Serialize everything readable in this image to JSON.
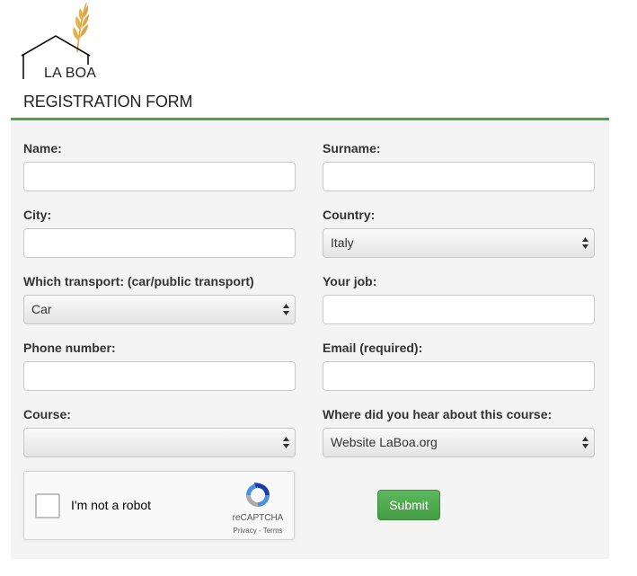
{
  "logo": {
    "text": "LA BOA",
    "icon": "house-wheat-icon"
  },
  "form": {
    "title": "REGISTRATION FORM",
    "name": {
      "label": "Name:",
      "value": ""
    },
    "surname": {
      "label": "Surname:",
      "value": ""
    },
    "city": {
      "label": "City:",
      "value": ""
    },
    "country": {
      "label": "Country:",
      "selected": "Italy"
    },
    "transport": {
      "label": "Which transport: (car/public transport)",
      "selected": "Car"
    },
    "job": {
      "label": "Your job:",
      "value": ""
    },
    "phone": {
      "label": "Phone number:",
      "value": ""
    },
    "email": {
      "label": "Email (required):",
      "value": ""
    },
    "course": {
      "label": "Course:",
      "selected": ""
    },
    "hear": {
      "label": "Where did you hear about this course:",
      "selected": "Website LaBoa.org"
    }
  },
  "recaptcha": {
    "label": "I'm not a robot",
    "brand": "reCAPTCHA",
    "links": "Privacy - Terms"
  },
  "submit": {
    "label": "Submit"
  },
  "colors": {
    "accent_green": "#4ea24b",
    "button_green": "#5cb85c",
    "panel_bg": "#f4f4f4"
  }
}
